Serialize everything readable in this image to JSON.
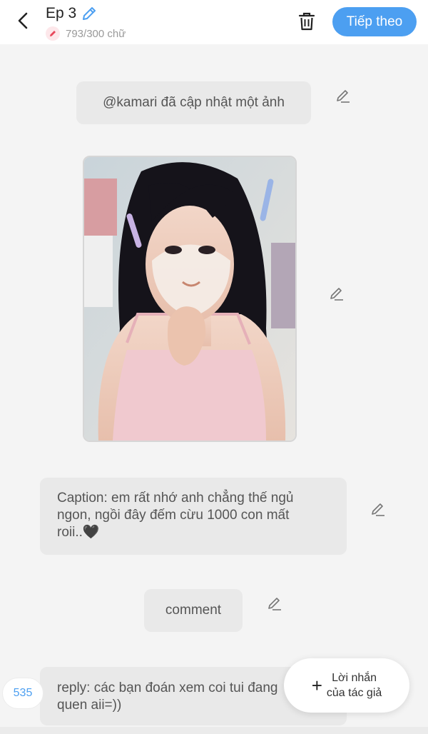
{
  "header": {
    "title": "Ep 3",
    "word_count": "793/300 chữ",
    "next_label": "Tiếp theo",
    "accent_color": "#4c9ff1"
  },
  "messages": {
    "update_notice": "@kamari đã cập nhật một ảnh",
    "caption_line1": "Caption: em rất nhớ anh chẳng thế ngủ",
    "caption_line2": "ngon, ngồi đây đếm cừu 1000 con mất",
    "caption_line3": "roii..🖤",
    "comment": "comment",
    "reply_line1": "reply: các bạn đoán xem coi tui đang",
    "reply_line2": "quen aii=))"
  },
  "reply_count": "535",
  "author_note": {
    "line1": "Lời nhắn",
    "line2": "của tác giả"
  },
  "icons": [
    "back-arrow-icon",
    "pencil-icon",
    "trash-icon",
    "plus-icon"
  ]
}
